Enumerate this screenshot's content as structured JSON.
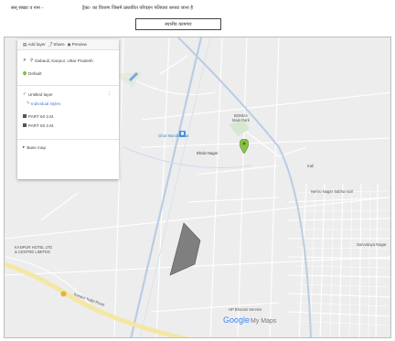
{
  "header": {
    "left_text": "सस् संख्या व नाम -",
    "right_text": "ट्रैक्ट-  का विवरण जिसमें प्रस्तावित परिवहन गलियारा बनाया जाना है",
    "box_text": "स्थानीय कामगार"
  },
  "panel": {
    "toolbar": {
      "add_layer": "Add layer",
      "share": "Share",
      "preview": "Preview"
    },
    "search": {
      "text": "Dabauli, Kanpur, Uttar Pradesh"
    },
    "pin_item": "Default",
    "layer": {
      "title": "Untitled layer",
      "link": "Individual styles"
    },
    "items": [
      "PART 60 2.M.",
      "PART 60 2.M."
    ],
    "base_map": "Base map"
  },
  "map": {
    "labels": {
      "area_top": "BONDA\nMain Park",
      "area_right": "Kali",
      "market": "Bhola Nagar",
      "pink": "Fazalgunj",
      "bus": "Ghar Mandir Ghat",
      "west_block": "KANPUR HOTEL LTD\n& CENTRE LIMITED",
      "right_1": "Nehru Nagar Sabha Hall",
      "right_2": "Sarvodaya Nagar",
      "bottom": "HP Bhoomi Service",
      "road": "Kanpur Kalpi Road"
    }
  },
  "brand": {
    "google": "Google",
    "mymaps": "My Maps"
  },
  "colors": {
    "road_major": "#b9cde4",
    "road_yellow": "#f3e7a6",
    "polygon": "#7f7f7f",
    "pin": "#8bc34a",
    "panel_link": "#4a7fc9"
  }
}
